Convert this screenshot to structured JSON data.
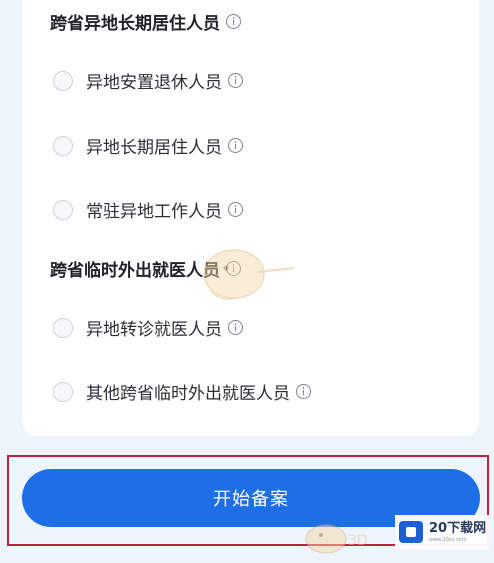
{
  "sections": [
    {
      "title": "跨省异地长期居住人员",
      "options": [
        "异地安置退休人员",
        "异地长期居住人员",
        "常驻异地工作人员"
      ]
    },
    {
      "title": "跨省临时外出就医人员",
      "options": [
        "异地转诊就医人员",
        "其他跨省临时外出就医人员"
      ]
    }
  ],
  "start_button_label": "开始备案",
  "watermark": {
    "name": "20下载网",
    "url": "www.20xz.com"
  },
  "colors": {
    "primary": "#1e6fe6",
    "highlight": "#c0203c"
  }
}
